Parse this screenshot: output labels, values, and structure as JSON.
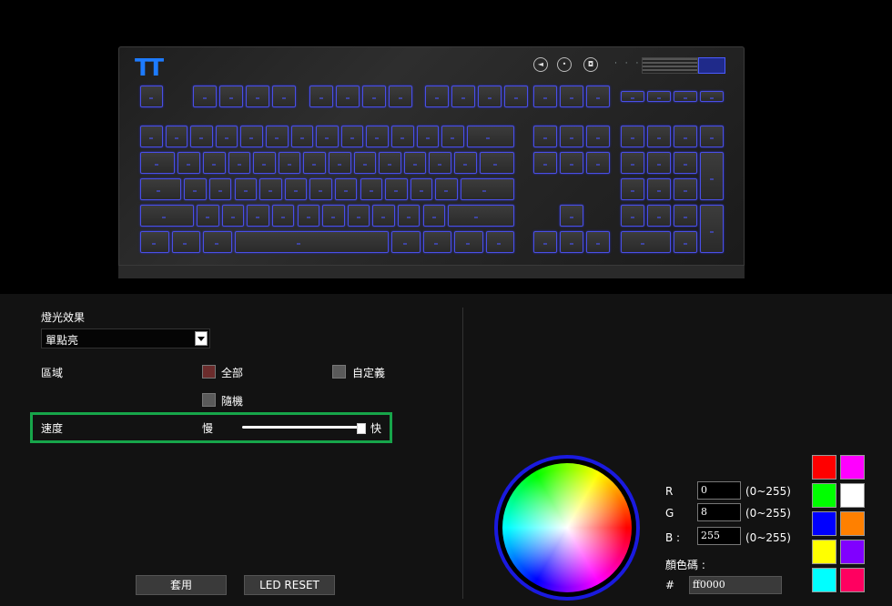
{
  "panel": {
    "effect_label": "燈光效果",
    "effect_value": "單點亮",
    "area_label": "區域",
    "opt_all": "全部",
    "opt_custom": "自定義",
    "opt_random": "隨機",
    "speed_label": "速度",
    "slow": "慢",
    "fast": "快",
    "speed_value": 1.0,
    "apply": "套用",
    "led_reset": "LED RESET"
  },
  "color": {
    "r_label": "R",
    "g_label": "G",
    "b_label": "B :",
    "r": "0",
    "g": "8",
    "b": "255",
    "range": "(0~255)",
    "code_label": "顏色碼 :",
    "hash": "#",
    "hex": "ff0000",
    "swatches": [
      "#ff0000",
      "#ff00ff",
      "#00ff00",
      "#ffffff",
      "#0000ff",
      "#ff8000",
      "#ffff00",
      "#8000ff",
      "#00ffff",
      "#ff0060"
    ]
  },
  "colors": {
    "highlight": "#17a54a",
    "key_glow": "#4a4fe6",
    "checked": "#6b2c2c"
  }
}
